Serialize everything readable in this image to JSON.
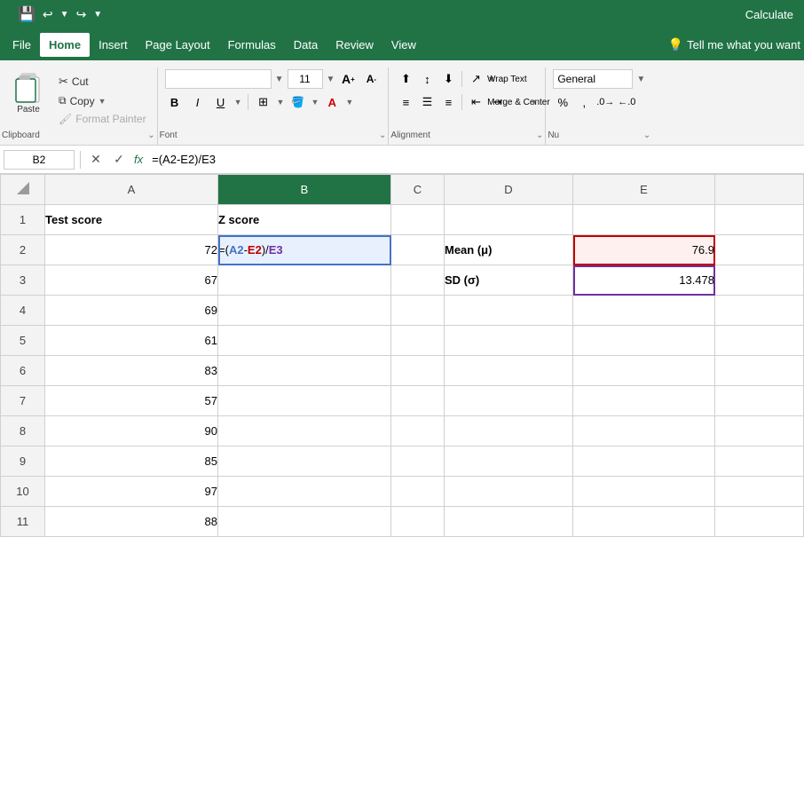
{
  "titlebar": {
    "text": "Calculate"
  },
  "menubar": {
    "items": [
      "File",
      "Home",
      "Insert",
      "Page Layout",
      "Formulas",
      "Data",
      "Review",
      "View"
    ],
    "active": "Home",
    "tell_me": "Tell me what you want"
  },
  "ribbon": {
    "clipboard": {
      "paste_label": "Paste",
      "cut_label": "Cut",
      "copy_label": "Copy",
      "format_painter_label": "Format Painter",
      "group_name": "Clipboard"
    },
    "font": {
      "name": "",
      "size": "11",
      "grow_label": "A",
      "shrink_label": "A",
      "bold": "B",
      "italic": "I",
      "underline": "U",
      "group_name": "Font"
    },
    "alignment": {
      "wrap_text": "Wrap Text",
      "merge_center": "Merge & Center",
      "group_name": "Alignment"
    },
    "number": {
      "format": "General",
      "group_name": "Nu"
    }
  },
  "formula_bar": {
    "cell_ref": "B2",
    "formula": "=(A2-E2)/E3"
  },
  "spreadsheet": {
    "col_headers": [
      "",
      "A",
      "B",
      "C",
      "D",
      "E",
      ""
    ],
    "rows": [
      {
        "row_num": "1",
        "cells": [
          "Test score",
          "Z score",
          "",
          "",
          "",
          ""
        ]
      },
      {
        "row_num": "2",
        "cells": [
          "72",
          "=(A2-E2)/E3",
          "",
          "Mean (μ)",
          "76.9",
          ""
        ]
      },
      {
        "row_num": "3",
        "cells": [
          "67",
          "",
          "",
          "SD (σ)",
          "13.478",
          ""
        ]
      },
      {
        "row_num": "4",
        "cells": [
          "69",
          "",
          "",
          "",
          "",
          ""
        ]
      },
      {
        "row_num": "5",
        "cells": [
          "61",
          "",
          "",
          "",
          "",
          ""
        ]
      },
      {
        "row_num": "6",
        "cells": [
          "83",
          "",
          "",
          "",
          "",
          ""
        ]
      },
      {
        "row_num": "7",
        "cells": [
          "57",
          "",
          "",
          "",
          "",
          ""
        ]
      },
      {
        "row_num": "8",
        "cells": [
          "90",
          "",
          "",
          "",
          "",
          ""
        ]
      },
      {
        "row_num": "9",
        "cells": [
          "85",
          "",
          "",
          "",
          "",
          ""
        ]
      },
      {
        "row_num": "10",
        "cells": [
          "97",
          "",
          "",
          "",
          "",
          ""
        ]
      },
      {
        "row_num": "11",
        "cells": [
          "88",
          "",
          "",
          "",
          "",
          ""
        ]
      }
    ]
  }
}
